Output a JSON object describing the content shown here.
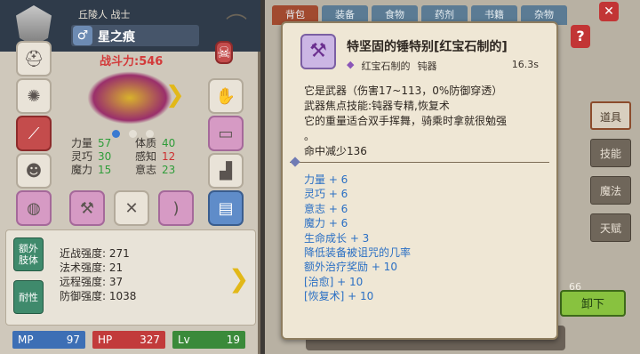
{
  "character": {
    "origin": "丘陵人 战士",
    "name": "星之痕",
    "gender_icon": "male-symbol-icon",
    "power": "战斗力:546",
    "stats": [
      {
        "label": "力量",
        "value": "57",
        "label2": "体质",
        "value2": "40"
      },
      {
        "label": "灵巧",
        "value": "30",
        "label2": "感知",
        "value2": "12"
      },
      {
        "label": "魔力",
        "value": "15",
        "label2": "意志",
        "value2": "23"
      }
    ],
    "bonus_tabs": [
      "额外\n肢体",
      "耐性"
    ],
    "bonus": [
      "近战强度: 271",
      "法术强度: 21",
      "远程强度: 37",
      "防御强度: 1038"
    ],
    "resources": {
      "mp_label": "MP",
      "mp": "97",
      "hp_label": "HP",
      "hp": "327",
      "lv_label": "Lv",
      "lv": "19"
    }
  },
  "bag": {
    "tabs": [
      "背包",
      "装备",
      "食物",
      "药剂",
      "书籍",
      "杂物"
    ],
    "side_tabs": [
      "道具",
      "技能",
      "魔法",
      "天赋"
    ],
    "unequip": "卸下",
    "count": "66"
  },
  "tooltip": {
    "name": "特坚固的锤特别[红宝石制的]",
    "rarity": "红宝石制的",
    "type": "钝器",
    "weight": "16.3s",
    "description": [
      "它是武器（伤害17~113，0%防御穿透）",
      "武器焦点技能:钝器专精,恢复术",
      "它的重量适合双手挥舞，骑乘时拿就很勉强",
      "。",
      "命中减少136"
    ],
    "bonuses": [
      "力量 + 6",
      "灵巧 + 6",
      "意志 + 6",
      "魔力 + 6",
      "生命成长 + 3",
      "降低装备被诅咒的几率",
      "额外治疗奖励 + 10",
      "[治愈] + 10",
      "[恢复术] + 10"
    ]
  },
  "colors": {
    "power": "#d33a3a",
    "stat_green": "#2f9d3a",
    "bonus_blue": "#2a6fc4",
    "mp": "#3d6fb5",
    "hp": "#c23b3b",
    "lv": "#3a8a3a"
  }
}
